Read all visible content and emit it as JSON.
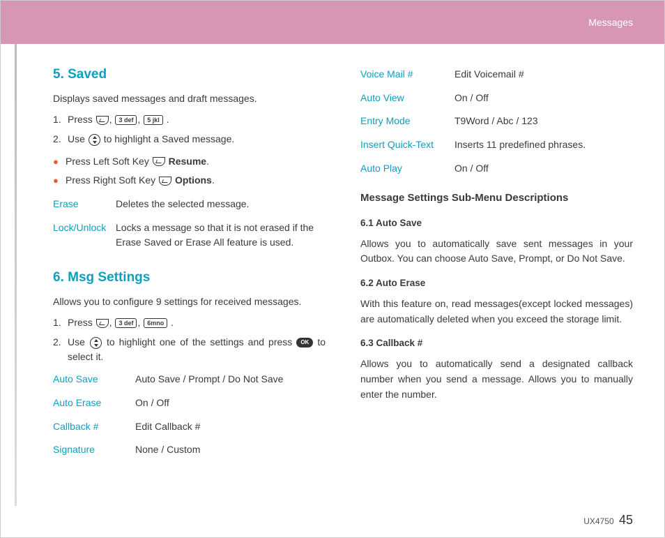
{
  "header": {
    "section": "Messages"
  },
  "footer": {
    "model": "UX4750",
    "page": "45"
  },
  "left": {
    "sec5": {
      "title": "5. Saved",
      "intro": "Displays saved messages and draft messages.",
      "step1_a": "Press",
      "step1_c": ",",
      "k1": "3 def",
      "k2": "5 jkl",
      "step2_a": "Use",
      "step2_b": "to highlight a Saved message.",
      "b1_a": "Press Left Soft Key",
      "b1_b": "Resume",
      "b1_c": ".",
      "b2_a": "Press Right Soft Key",
      "b2_b": "Options",
      "b2_c": ".",
      "t": {
        "erase_k": "Erase",
        "erase_v": "Deletes the selected message.",
        "lock_k": "Lock/Unlock",
        "lock_v": "Locks a message so that it is not erased if the Erase Saved or Erase All feature is used."
      }
    },
    "sec6": {
      "title": "6. Msg Settings",
      "intro": "Allows you to configure 9 settings for received messages.",
      "step1_a": "Press",
      "k1": "3 def",
      "k2": "6mno",
      "c": ",",
      "step2_a": "Use",
      "step2_b": "to highlight one of the settings and press",
      "step2_c": "to select it.",
      "t": {
        "as_k": "Auto Save",
        "as_v": "Auto Save / Prompt / Do Not Save",
        "ae_k": "Auto Erase",
        "ae_v": "On / Off",
        "cb_k": "Callback #",
        "cb_v": "Edit Callback #",
        "sig_k": "Signature",
        "sig_v": "None / Custom"
      }
    }
  },
  "right": {
    "t": {
      "vm_k": "Voice Mail #",
      "vm_v": "Edit Voicemail #",
      "av_k": "Auto View",
      "av_v": "On / Off",
      "em_k": "Entry Mode",
      "em_v": "T9Word / Abc / 123",
      "iq_k": "Insert Quick-Text",
      "iq_v": "Inserts 11 predefined phrases.",
      "ap_k": "Auto Play",
      "ap_v": "On / Off"
    },
    "subhead": "Message Settings Sub-Menu Descriptions",
    "d61": {
      "h": "6.1 Auto Save",
      "p": "Allows you to automatically save sent messages in your Outbox. You can choose Auto Save, Prompt, or Do Not Save."
    },
    "d62": {
      "h": "6.2 Auto Erase",
      "p": "With this feature on, read messages(except locked messages) are automatically deleted when you exceed the storage limit."
    },
    "d63": {
      "h": "6.3 Callback #",
      "p": "Allows you to automatically send a designated callback number when you send a message. Allows you to manually enter the number."
    }
  }
}
